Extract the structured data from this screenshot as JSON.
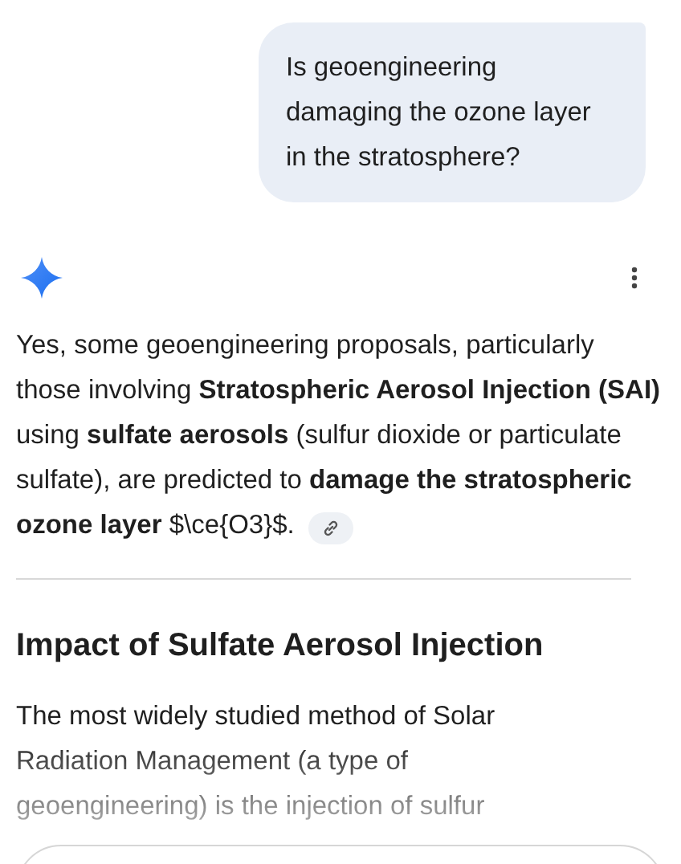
{
  "user_message": {
    "text": "Is geoengineering damaging the ozone layer in the stratosphere?"
  },
  "response": {
    "paragraphs": [
      "Yes, some geoengineering proposals, particularly those involving **Stratospheric Aerosol Injection (SAI)** using **sulfate aerosols** (sulfur dioxide or particulate sulfate), are predicted to **damage the stratospheric ozone layer** $\\ce{O3}$."
    ],
    "heading": "Impact of Sulfate Aerosol Injection",
    "faded_paragraph": "The most widely studied method of Solar Radiation Management (a type of geoengineering) is the injection of sulfur"
  }
}
